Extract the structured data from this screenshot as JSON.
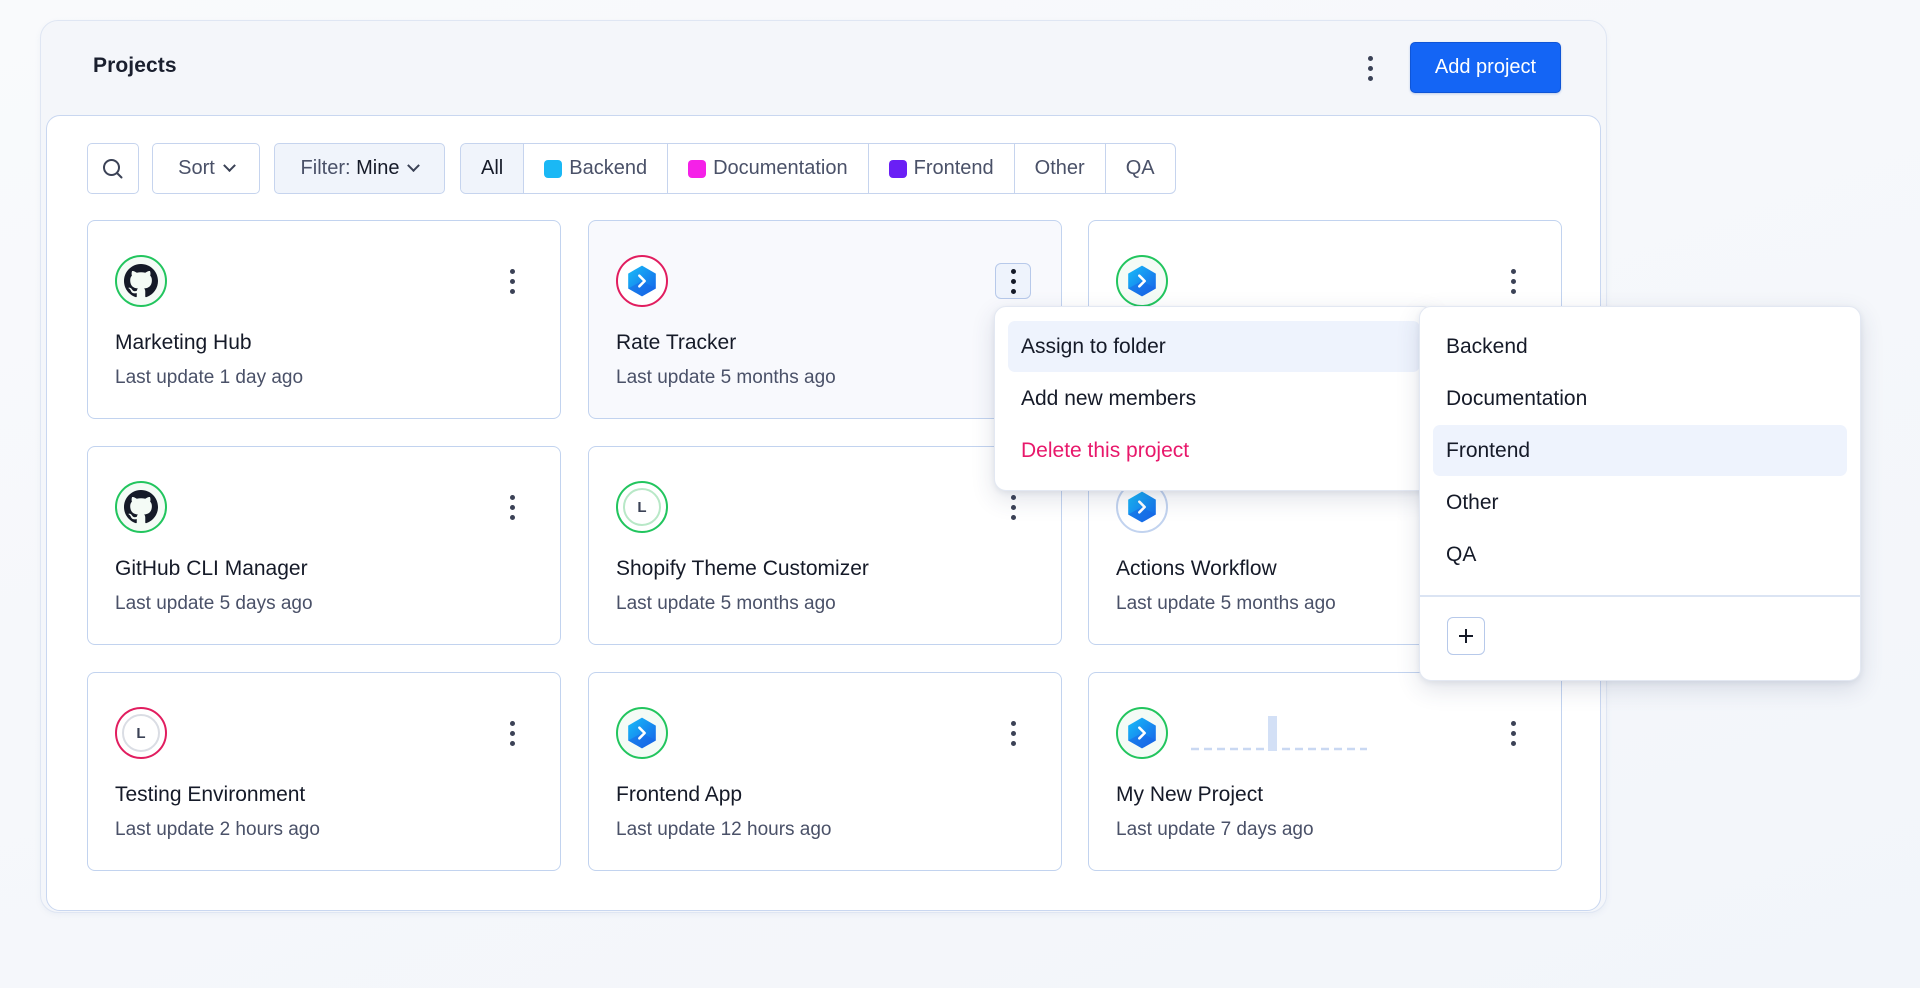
{
  "header": {
    "title": "Projects",
    "more_icon": "kebab-vertical-icon",
    "add_project_label": "Add project"
  },
  "toolbar": {
    "search_icon": "search-icon",
    "sort_label": "Sort",
    "filter_prefix": "Filter:",
    "filter_value": "Mine",
    "folder_tabs": [
      {
        "label": "All",
        "active": true,
        "color": null
      },
      {
        "label": "Backend",
        "active": false,
        "color": "#1ab8f5"
      },
      {
        "label": "Documentation",
        "active": false,
        "color": "#f521e8"
      },
      {
        "label": "Frontend",
        "active": false,
        "color": "#6a1ff5"
      },
      {
        "label": "Other",
        "active": false,
        "color": null
      },
      {
        "label": "QA",
        "active": false,
        "color": null
      }
    ]
  },
  "projects": [
    {
      "name": "Marketing Hub",
      "updated": "Last update 1 day ago",
      "icon": "github-icon",
      "status_color": "#22c55e"
    },
    {
      "name": "Rate Tracker",
      "updated": "Last update 5 months ago",
      "icon": "hexagon-app-icon",
      "status_color": "#e11d5f"
    },
    {
      "name": "",
      "updated": "",
      "icon": "hexagon-app-icon",
      "status_color": "#22c55e"
    },
    {
      "name": "GitHub CLI Manager",
      "updated": "Last update 5 days ago",
      "icon": "github-icon",
      "status_color": "#22c55e"
    },
    {
      "name": "Shopify Theme Customizer",
      "updated": "Last update 5 months ago",
      "icon": "letter-avatar",
      "letter": "L",
      "status_color": "#22c55e"
    },
    {
      "name": "Actions Workflow",
      "updated": "Last update 5 months ago",
      "icon": "hexagon-app-icon",
      "status_color": "#c2d3ef"
    },
    {
      "name": "Testing Environment",
      "updated": "Last update 2 hours ago",
      "icon": "letter-avatar",
      "letter": "L",
      "status_color": "#e11d5f"
    },
    {
      "name": "Frontend App",
      "updated": "Last update 12 hours ago",
      "icon": "hexagon-app-icon",
      "status_color": "#22c55e"
    },
    {
      "name": "My New Project",
      "updated": "Last update 7 days ago",
      "icon": "hexagon-app-icon",
      "status_color": "#22c55e"
    }
  ],
  "context_menu": {
    "items": [
      {
        "label": "Assign to folder",
        "highlighted": true
      },
      {
        "label": "Add new members",
        "highlighted": false
      },
      {
        "label": "Delete this project",
        "danger": true
      }
    ]
  },
  "folder_submenu": {
    "items": [
      {
        "label": "Backend",
        "highlighted": false
      },
      {
        "label": "Documentation",
        "highlighted": false
      },
      {
        "label": "Frontend",
        "highlighted": true
      },
      {
        "label": "Other",
        "highlighted": false
      },
      {
        "label": "QA",
        "highlighted": false
      }
    ],
    "add_icon": "plus-icon"
  },
  "colors": {
    "primary": "#1465f5",
    "danger": "#e8186b",
    "status_ok": "#22c55e",
    "status_error": "#e11d5f"
  }
}
